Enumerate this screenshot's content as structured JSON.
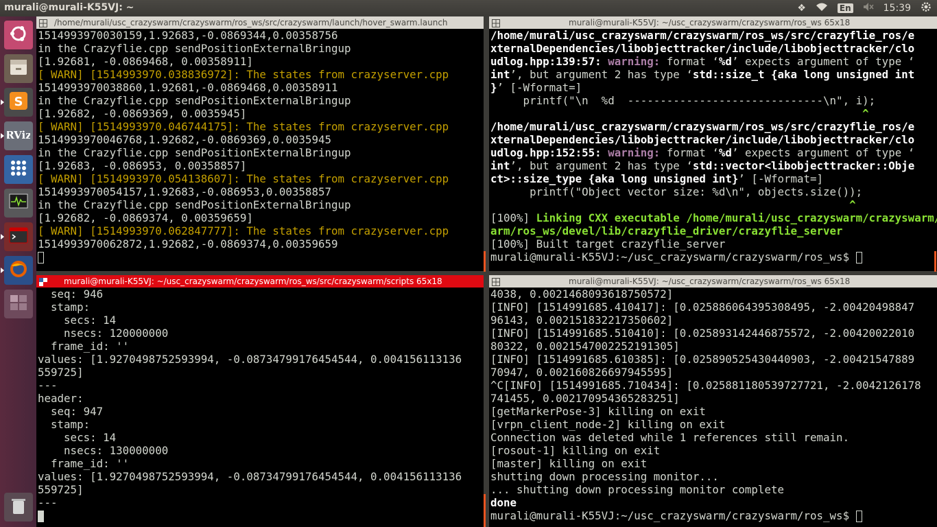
{
  "topbar": {
    "window_title": "murali@murali-K55VJ: ~",
    "lang": "En",
    "clock": "15:39"
  },
  "launcher": {
    "items": [
      {
        "name": "ubuntu-dash-icon",
        "label": "Dash"
      },
      {
        "name": "files-icon",
        "label": "Files"
      },
      {
        "name": "sublime-text-icon",
        "label": "S"
      },
      {
        "name": "rviz-icon",
        "label": "RViz"
      },
      {
        "name": "apps-grid-icon",
        "label": "Apps"
      },
      {
        "name": "system-monitor-icon",
        "label": "System Monitor"
      },
      {
        "name": "terminal-icon",
        "label": "Terminal"
      },
      {
        "name": "firefox-icon",
        "label": "Firefox"
      },
      {
        "name": "workspace-switcher-icon",
        "label": "Workspaces"
      },
      {
        "name": "trash-icon",
        "label": "Trash"
      }
    ]
  },
  "terminals": {
    "top_left": {
      "title": "/home/murali/usc_crazyswarm/crazyswarm/ros_ws/src/crazyswarm/launch/hover_swarm.launch",
      "lines": [
        {
          "t": "1514993970030159,1.92683,-0.0869344,0.00358756",
          "c": ""
        },
        {
          "t": "in the Crazyflie.cpp sendPositionExternalBringup",
          "c": ""
        },
        {
          "t": "[1.92681, -0.0869468, 0.00358911]",
          "c": ""
        },
        {
          "t": "[ WARN] [1514993970.038836972]: The states from crazyserver.cpp",
          "c": "warn"
        },
        {
          "t": "1514993970038860,1.92681,-0.0869468,0.00358911",
          "c": ""
        },
        {
          "t": "in the Crazyflie.cpp sendPositionExternalBringup",
          "c": ""
        },
        {
          "t": "[1.92682, -0.0869369, 0.0035945]",
          "c": ""
        },
        {
          "t": "[ WARN] [1514993970.046744175]: The states from crazyserver.cpp",
          "c": "warn"
        },
        {
          "t": "1514993970046768,1.92682,-0.0869369,0.0035945",
          "c": ""
        },
        {
          "t": "in the Crazyflie.cpp sendPositionExternalBringup",
          "c": ""
        },
        {
          "t": "[1.92683, -0.086953, 0.00358857]",
          "c": ""
        },
        {
          "t": "[ WARN] [1514993970.054138607]: The states from crazyserver.cpp",
          "c": "warn"
        },
        {
          "t": "1514993970054157,1.92683,-0.086953,0.00358857",
          "c": ""
        },
        {
          "t": "in the Crazyflie.cpp sendPositionExternalBringup",
          "c": ""
        },
        {
          "t": "[1.92682, -0.0869374, 0.00359659]",
          "c": ""
        },
        {
          "t": "[ WARN] [1514993970.062847777]: The states from crazyserver.cpp",
          "c": "warn"
        },
        {
          "t": "1514993970062872,1.92682,-0.0869374,0.00359659",
          "c": ""
        }
      ]
    },
    "top_right": {
      "title": "murali@murali-K55VJ: ~/usc_crazyswarm/crazyswarm/ros_ws 65x18",
      "l0": "/home/murali/usc_crazyswarm/crazyswarm/ros_ws/src/crazyflie_ros/e",
      "l1": "xternalDependencies/libobjecttracker/include/libobjecttracker/clo",
      "l2a": "udlog.hpp:139:57: ",
      "l2b": "warning: ",
      "l2c": "format ‘",
      "l2d": "%d",
      "l2e": "’ expects argument of type ‘",
      "l3a": "int",
      "l3b": "’, but argument 2 has type ‘",
      "l3c": "std::size_t {aka long unsigned int",
      "l4a": "}",
      "l4b": "’ [-Wformat=]",
      "l5": "     printf(\"\\n  %d  ------------------------------\\n\", i);",
      "l6": "                                                         ^",
      "l7": "/home/murali/usc_crazyswarm/crazyswarm/ros_ws/src/crazyflie_ros/e",
      "l8": "xternalDependencies/libobjecttracker/include/libobjecttracker/clo",
      "l9a": "udlog.hpp:152:55: ",
      "l9b": "warning: ",
      "l9c": "format ‘",
      "l9d": "%d",
      "l9e": "’ expects argument of type ‘",
      "l10a": "int",
      "l10b": "’, but argument 2 has type ‘",
      "l10c": "std::vector<libobjecttracker::Obje",
      "l11a": "ct>::size_type {aka long unsigned int}",
      "l11b": "’ [-Wformat=]",
      "l12": "      printf(\"Object vector size: %d\\n\", objects.size());",
      "l13": "                                                       ^",
      "l14a": "[100%] ",
      "l14b": "Linking CXX executable /home/murali/usc_crazyswarm/crazyswarm/crazys",
      "l15": "arm/ros_ws/devel/lib/crazyflie_driver/crazyflie_server",
      "l16": "[100%] Built target crazyflie_server",
      "l17": "murali@murali-K55VJ:~/usc_crazyswarm/crazyswarm/ros_ws$ "
    },
    "bottom_left": {
      "title": "murali@murali-K55VJ: ~/usc_crazyswarm/crazyswarm/ros_ws/src/crazyswarm/scripts 65x18",
      "lines": [
        "  seq: 946",
        "  stamp: ",
        "    secs: 14",
        "    nsecs: 120000000",
        "  frame_id: ''",
        "values: [1.9270498752593994, -0.08734799176454544, 0.004156113136",
        "559725]",
        "---",
        "header: ",
        "  seq: 947",
        "  stamp: ",
        "    secs: 14",
        "    nsecs: 130000000",
        "  frame_id: ''",
        "values: [1.9270498752593994, -0.08734799176454544, 0.004156113136",
        "559725]",
        "---"
      ]
    },
    "bottom_right": {
      "title": "murali@murali-K55VJ: ~/usc_crazyswarm/crazyswarm/ros_ws 65x18",
      "lines": [
        {
          "t": "4038, 0.0021468093618750572]",
          "c": ""
        },
        {
          "t": "[INFO] [1514991685.410417]: [0.025886064395308495, -2.00420498847",
          "c": ""
        },
        {
          "t": "96143, 0.002151832217350602]",
          "c": ""
        },
        {
          "t": "[INFO] [1514991685.510410]: [0.025893142446875572, -2.00420022010",
          "c": ""
        },
        {
          "t": "80322, 0.0021547002252191305]",
          "c": ""
        },
        {
          "t": "[INFO] [1514991685.610385]: [0.025890525430440903, -2.00421547889",
          "c": ""
        },
        {
          "t": "70947, 0.002160826697945595]",
          "c": ""
        },
        {
          "t": "^C[INFO] [1514991685.710434]: [0.025881180539727721, -2.0042126178",
          "c": ""
        },
        {
          "t": "741455, 0.002170954365283251]",
          "c": ""
        },
        {
          "t": "[getMarkerPose-3] killing on exit",
          "c": ""
        },
        {
          "t": "[vrpn_client_node-2] killing on exit",
          "c": ""
        },
        {
          "t": "Connection was deleted while 1 references still remain.",
          "c": ""
        },
        {
          "t": "[rosout-1] killing on exit",
          "c": ""
        },
        {
          "t": "[master] killing on exit",
          "c": ""
        },
        {
          "t": "shutting down processing monitor...",
          "c": ""
        },
        {
          "t": "... shutting down processing monitor complete",
          "c": ""
        },
        {
          "t": "done",
          "c": "b"
        }
      ],
      "prompt": "murali@murali-K55VJ:~/usc_crazyswarm/crazyswarm/ros_ws$ "
    }
  }
}
